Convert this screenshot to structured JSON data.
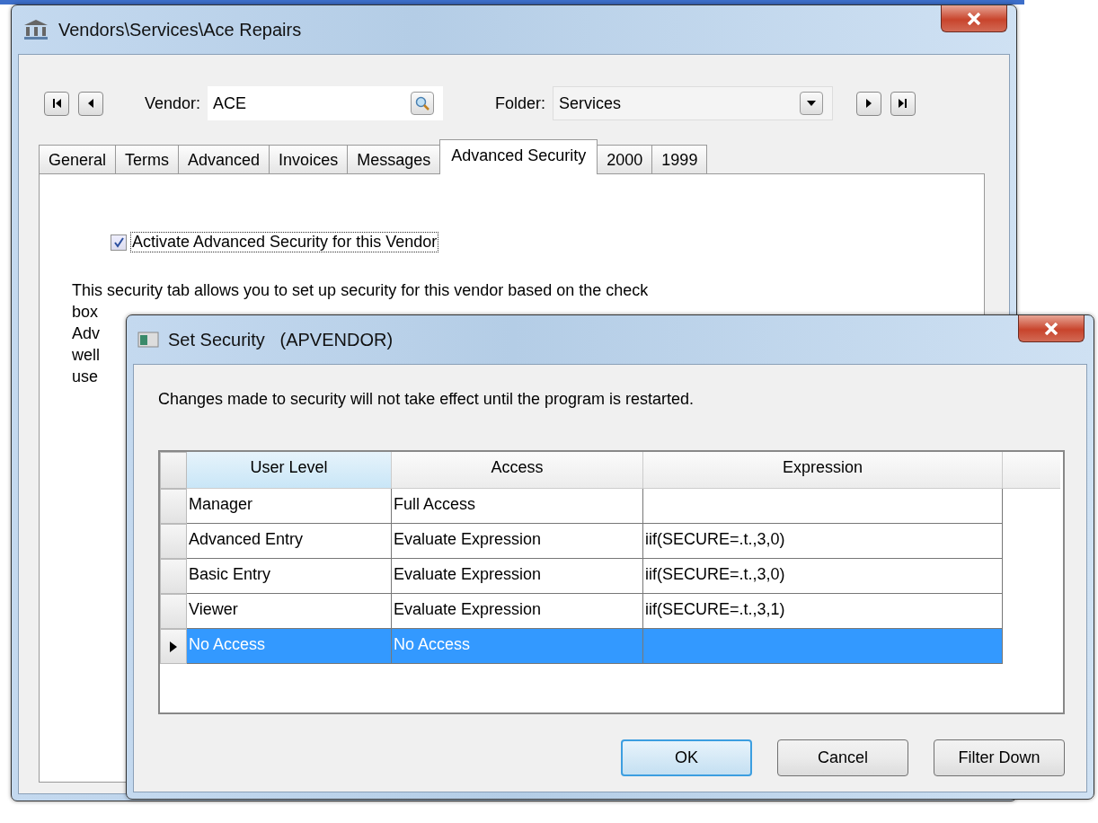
{
  "main_window": {
    "title": "Vendors\\Services\\Ace Repairs",
    "vendor": {
      "label": "Vendor:",
      "value": "ACE"
    },
    "folder": {
      "label": "Folder:",
      "value": "Services"
    },
    "tabs": [
      {
        "label": "General",
        "selected": false
      },
      {
        "label": "Terms",
        "selected": false
      },
      {
        "label": "Advanced",
        "selected": false
      },
      {
        "label": "Invoices",
        "selected": false
      },
      {
        "label": "Messages",
        "selected": false
      },
      {
        "label": "Advanced Security",
        "selected": true
      },
      {
        "label": "2000",
        "selected": false
      },
      {
        "label": "1999",
        "selected": false
      }
    ],
    "checkbox": {
      "label": "Activate Advanced Security for this Vendor",
      "checked": true
    },
    "description_lines": [
      "This security tab allows you to set up security for this vendor based on the check",
      "box",
      "Adv",
      "well",
      "use"
    ]
  },
  "dialog": {
    "title": "Set Security   (APVENDOR)",
    "message": "Changes made to security will not take effect until the program is restarted.",
    "table": {
      "columns": [
        "User Level",
        "Access",
        "Expression"
      ],
      "rows": [
        {
          "cells": [
            "Manager",
            "Full Access",
            ""
          ],
          "selected": false
        },
        {
          "cells": [
            "Advanced Entry",
            "Evaluate Expression",
            "iif(SECURE=.t.,3,0)"
          ],
          "selected": false
        },
        {
          "cells": [
            "Basic Entry",
            "Evaluate Expression",
            "iif(SECURE=.t.,3,0)"
          ],
          "selected": false
        },
        {
          "cells": [
            "Viewer",
            "Evaluate Expression",
            "iif(SECURE=.t.,3,1)"
          ],
          "selected": false
        },
        {
          "cells": [
            "No Access",
            "No Access",
            ""
          ],
          "selected": true
        }
      ]
    },
    "buttons": [
      {
        "label": "OK",
        "default": true
      },
      {
        "label": "Cancel",
        "default": false
      },
      {
        "label": "Filter Down",
        "default": false
      }
    ]
  }
}
